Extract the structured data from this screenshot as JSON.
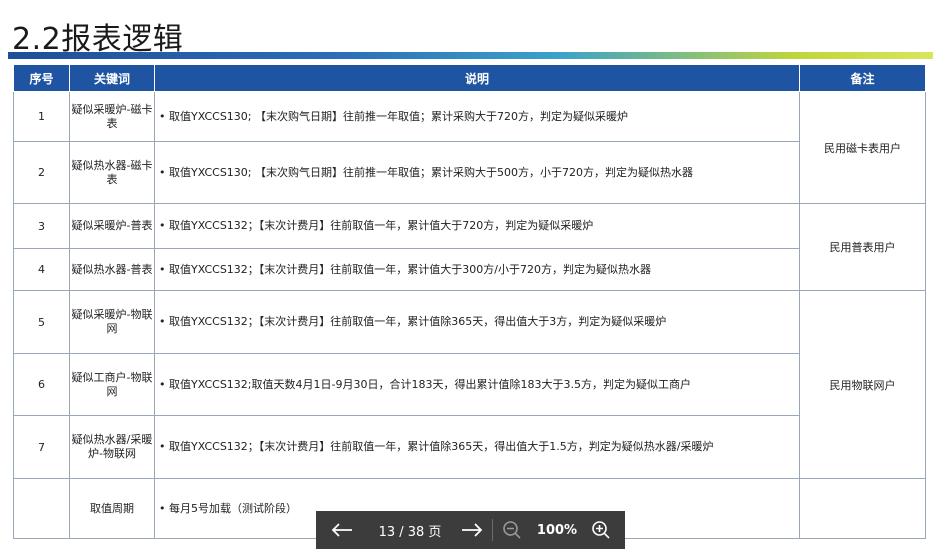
{
  "slide": {
    "title": "2.2报表逻辑"
  },
  "table": {
    "headers": {
      "index": "序号",
      "keyword": "关键词",
      "description": "说明",
      "note": "备注"
    },
    "rows": [
      {
        "index": "1",
        "keyword": "疑似采暖炉-磁卡表",
        "description": "取值YXCCS130; 【末次购气日期】往前推一年取值；累计采购大于720方，判定为疑似采暖炉"
      },
      {
        "index": "2",
        "keyword": "疑似热水器-磁卡表",
        "description": "取值YXCCS130; 【末次购气日期】往前推一年取值；累计采购大于500方，小于720方，判定为疑似热水器"
      },
      {
        "index": "3",
        "keyword": "疑似采暖炉-普表",
        "description": "取值YXCCS132；【末次计费月】往前取值一年，累计值大于720方，判定为疑似采暖炉"
      },
      {
        "index": "4",
        "keyword": "疑似热水器-普表",
        "description": "取值YXCCS132；【末次计费月】往前取值一年，累计值大于300方/小于720方，判定为疑似热水器"
      },
      {
        "index": "5",
        "keyword": "疑似采暖炉-物联网",
        "description": "取值YXCCS132；【末次计费月】往前取值一年，累计值除365天，得出值大于3方，判定为疑似采暖炉"
      },
      {
        "index": "6",
        "keyword": "疑似工商户-物联网",
        "description": "取值YXCCS132;取值天数4月1日-9月30日，合计183天，得出累计值除183大于3.5方，判定为疑似工商户"
      },
      {
        "index": "7",
        "keyword": "疑似热水器/采暖炉-物联网",
        "description": "取值YXCCS132；【末次计费月】往前取值一年，累计值除365天，得出值大于1.5方，判定为疑似热水器/采暖炉"
      },
      {
        "index": "",
        "keyword": "取值周期",
        "description": "每月5号加载（测试阶段）"
      }
    ],
    "notes": {
      "group1": "民用磁卡表用户",
      "group2": "民用普表用户",
      "group3": "民用物联网户"
    }
  },
  "viewer": {
    "prev_icon": "arrow-left-icon",
    "page_indicator": "13 / 38 页",
    "next_icon": "arrow-right-icon",
    "zoom_out_icon": "zoom-out-icon",
    "zoom_level": "100%",
    "zoom_in_icon": "zoom-in-icon"
  }
}
